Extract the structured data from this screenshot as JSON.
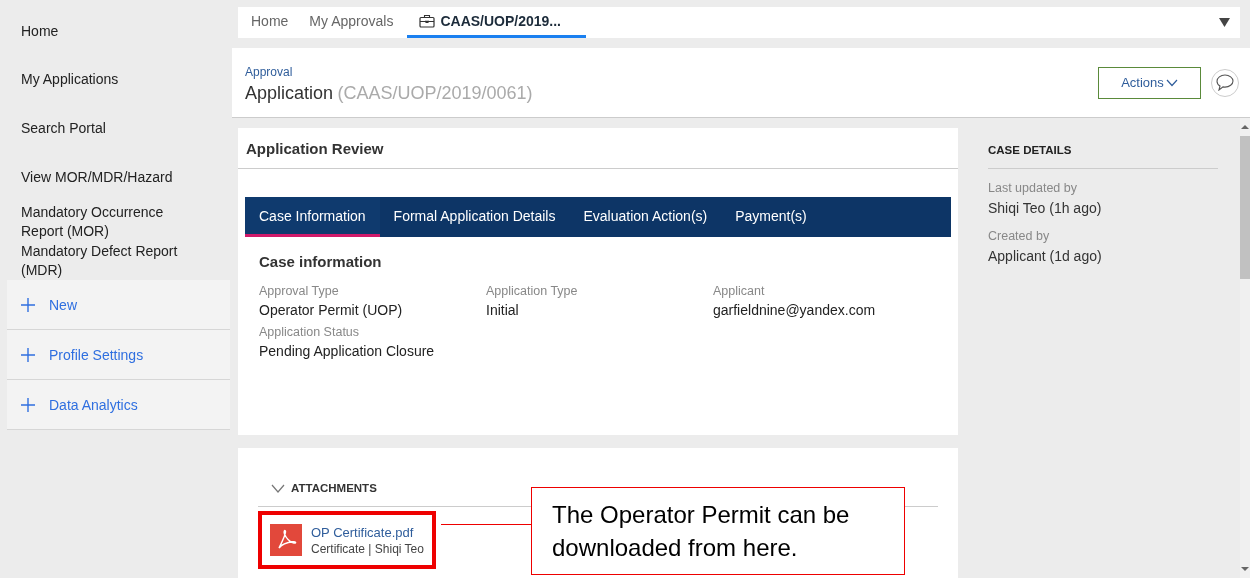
{
  "sidebar": {
    "items": [
      {
        "label": "Home",
        "kind": "link"
      },
      {
        "label": "My Applications",
        "kind": "link"
      },
      {
        "label": "Search Portal",
        "kind": "link"
      },
      {
        "label": "View MOR/MDR/Hazard",
        "kind": "link"
      },
      {
        "label": "Mandatory Occurrence Report (MOR)",
        "kind": "link"
      },
      {
        "label": "Mandatory Defect Report (MDR)",
        "kind": "link"
      },
      {
        "label": "New",
        "kind": "expander"
      },
      {
        "label": "Profile Settings",
        "kind": "expander"
      },
      {
        "label": "Data Analytics",
        "kind": "expander"
      }
    ]
  },
  "top_tabs": [
    {
      "label": "Home",
      "kind": "page",
      "selected": false
    },
    {
      "label": "My Approvals",
      "kind": "page",
      "selected": false
    },
    {
      "label": "CAAS/UOP/2019...",
      "kind": "case",
      "selected": true
    }
  ],
  "header": {
    "breadcrumb": "Approval",
    "title": "Application",
    "case_id": "(CAAS/UOP/2019/0061)",
    "actions_button": "Actions"
  },
  "review": {
    "title": "Application Review",
    "tabs": [
      {
        "label": "Case Information",
        "selected": true
      },
      {
        "label": "Formal Application Details",
        "selected": false
      },
      {
        "label": "Evaluation Action(s)",
        "selected": false
      },
      {
        "label": "Payment(s)",
        "selected": false
      }
    ],
    "section_title": "Case information",
    "fields": [
      {
        "label": "Approval Type",
        "value": "Operator Permit (UOP)"
      },
      {
        "label": "Application Type",
        "value": "Initial"
      },
      {
        "label": "Applicant",
        "value": "garfieldnine@yandex.com"
      },
      {
        "label": "Application Status",
        "value": "Pending Application Closure"
      }
    ]
  },
  "attachments": {
    "title": "ATTACHMENTS",
    "expanded": true,
    "files": [
      {
        "name": "OP Certificate.pdf",
        "meta": "Certificate | Shiqi Teo",
        "highlighted": true
      }
    ]
  },
  "case_details": {
    "title": "CASE DETAILS",
    "fields": [
      {
        "label": "Last updated by",
        "value": "Shiqi Teo (1h ago)"
      },
      {
        "label": "Created by",
        "value": "Applicant (1d ago)"
      }
    ]
  },
  "callout": {
    "text": "The Operator Permit can be downloaded from here."
  }
}
